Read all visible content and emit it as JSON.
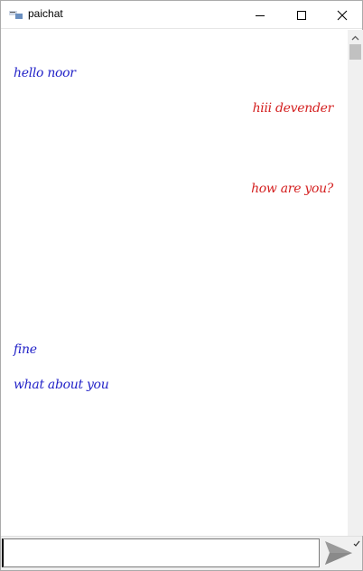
{
  "window": {
    "title": "paichat"
  },
  "icons": {
    "app": "paichat-app-icon",
    "minimize": "minimize-icon",
    "maximize": "maximize-icon",
    "close": "close-icon",
    "send": "send-arrow-icon",
    "scroll_up": "scroll-up-icon",
    "check": "checkmark-icon"
  },
  "messages": [
    {
      "text": "hello noor",
      "direction": "incoming"
    },
    {
      "text": "hiii devender",
      "direction": "outgoing"
    },
    {
      "text": "how are you?",
      "direction": "outgoing"
    },
    {
      "text": "fine",
      "direction": "incoming"
    },
    {
      "text": "what about you",
      "direction": "incoming"
    }
  ],
  "input": {
    "value": "",
    "placeholder": ""
  },
  "colors": {
    "incoming": "#2323c8",
    "outgoing": "#d42020",
    "send_icon": "#9a9a9a"
  }
}
